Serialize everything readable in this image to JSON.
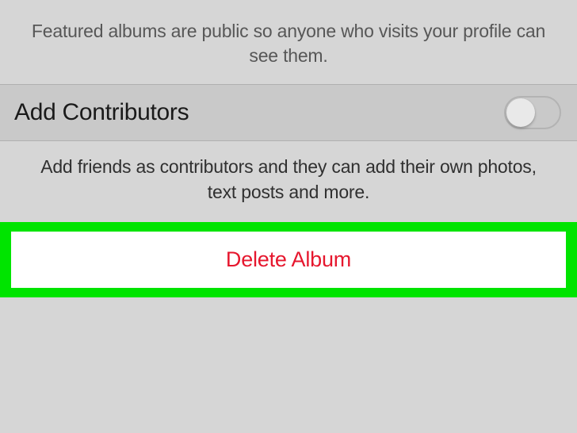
{
  "featured": {
    "description": "Featured albums are public so anyone who visits your profile can see them."
  },
  "contributors": {
    "label": "Add Contributors",
    "toggle_on": false,
    "description": "Add friends as contributors and they can add their own photos, text posts and more."
  },
  "delete": {
    "label": "Delete Album"
  }
}
